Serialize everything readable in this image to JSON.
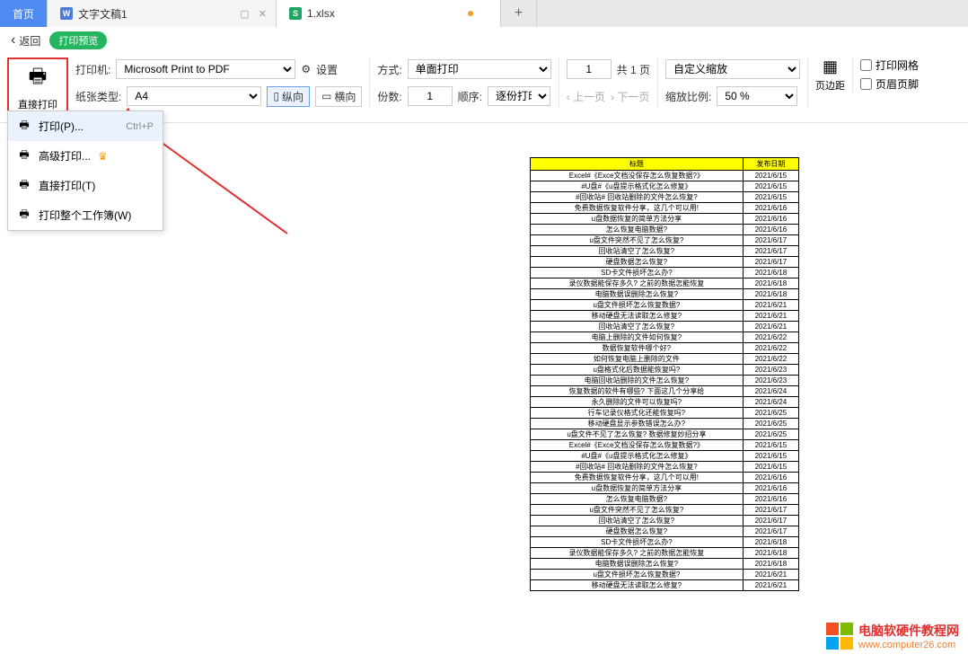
{
  "tabs": {
    "home": "首页",
    "doc": "文字文稿1",
    "excel": "1.xlsx"
  },
  "back": "返回",
  "preview_label": "打印预览",
  "toolbar": {
    "direct_print": "直接打印",
    "printer_label": "打印机:",
    "printer_value": "Microsoft Print to PDF",
    "paper_label": "纸张类型:",
    "paper_value": "A4",
    "settings": "设置",
    "portrait": "纵向",
    "landscape": "横向",
    "mode_label": "方式:",
    "mode_value": "单面打印",
    "copies_label": "份数:",
    "copies_value": "1",
    "order_label": "顺序:",
    "order_value": "逐份打印",
    "page_input": "1",
    "page_total": "共 1 页",
    "prev_page": "上一页",
    "next_page": "下一页",
    "zoom_label": "自定义缩放",
    "ratio_label": "缩放比例:",
    "ratio_value": "50 %",
    "margin": "页边距",
    "grid_chk": "打印网格",
    "header_footer": "页眉页脚"
  },
  "menu": {
    "print_p": "打印(P)...",
    "print_p_short": "Ctrl+P",
    "adv_print": "高级打印...",
    "direct_t": "直接打印(T)",
    "whole_book": "打印整个工作簿(W)"
  },
  "sheet": {
    "col1": "标题",
    "col2": "发布日期",
    "rows": [
      [
        "Excel#《Exce文档没保存怎么恢复数据?》",
        "2021/6/15"
      ],
      [
        "#U盘#《u盘提示格式化怎么修复》",
        "2021/6/15"
      ],
      [
        "#回收站# 回收站删除的文件怎么恢复?",
        "2021/6/15"
      ],
      [
        "免费数据恢复软件分享，这几个可以用!",
        "2021/6/16"
      ],
      [
        "u盘数据恢复的简单方法分享",
        "2021/6/16"
      ],
      [
        "怎么恢复电脑数据?",
        "2021/6/16"
      ],
      [
        "u盘文件突然不见了怎么恢复?",
        "2021/6/17"
      ],
      [
        "回收站清空了怎么恢复?",
        "2021/6/17"
      ],
      [
        "硬盘数据怎么恢复?",
        "2021/6/17"
      ],
      [
        "SD卡文件损坏怎么办?",
        "2021/6/18"
      ],
      [
        "录仪数据能保存多久? 之前的数据怎能恢复",
        "2021/6/18"
      ],
      [
        "电脑数据误删除怎么恢复?",
        "2021/6/18"
      ],
      [
        "u盘文件损坏怎么恢复数据?",
        "2021/6/21"
      ],
      [
        "移动硬盘无法读取怎么修复?",
        "2021/6/21"
      ],
      [
        "回收站清空了怎么恢复?",
        "2021/6/21"
      ],
      [
        "电脑上删除的文件如何恢复?",
        "2021/6/22"
      ],
      [
        "数据恢复软件哪个好?",
        "2021/6/22"
      ],
      [
        "如何恢复电脑上删除的文件",
        "2021/6/22"
      ],
      [
        "u盘格式化后数据能恢复吗?",
        "2021/6/23"
      ],
      [
        "电脑回收站删除的文件怎么恢复?",
        "2021/6/23"
      ],
      [
        "恢复数据的软件有哪些? 下面这几个分享给",
        "2021/6/24"
      ],
      [
        "永久删除的文件可以恢复吗?",
        "2021/6/24"
      ],
      [
        "行车记录仪格式化还能恢复吗?",
        "2021/6/25"
      ],
      [
        "移动硬盘显示参数错误怎么办?",
        "2021/6/25"
      ],
      [
        "u盘文件不见了怎么恢复? 数据修复妙招分享",
        "2021/6/25"
      ],
      [
        "Excel#《Exce文档没保存怎么恢复数据?》",
        "2021/6/15"
      ],
      [
        "#U盘#《u盘提示格式化怎么修复》",
        "2021/6/15"
      ],
      [
        "#回收站# 回收站删除的文件怎么恢复?",
        "2021/6/15"
      ],
      [
        "免费数据恢复软件分享，这几个可以用!",
        "2021/6/16"
      ],
      [
        "u盘数据恢复的简单方法分享",
        "2021/6/16"
      ],
      [
        "怎么恢复电脑数据?",
        "2021/6/16"
      ],
      [
        "u盘文件突然不见了怎么恢复?",
        "2021/6/17"
      ],
      [
        "回收站清空了怎么恢复?",
        "2021/6/17"
      ],
      [
        "硬盘数据怎么恢复?",
        "2021/6/17"
      ],
      [
        "SD卡文件损坏怎么办?",
        "2021/6/18"
      ],
      [
        "录仪数据能保存多久? 之前的数据怎能恢复",
        "2021/6/18"
      ],
      [
        "电脑数据误删除怎么恢复?",
        "2021/6/18"
      ],
      [
        "u盘文件损坏怎么恢复数据?",
        "2021/6/21"
      ],
      [
        "移动硬盘无法读取怎么修复?",
        "2021/6/21"
      ]
    ]
  },
  "watermark": {
    "text": "电脑软硬件教程网",
    "url": "www.computer26.com"
  }
}
